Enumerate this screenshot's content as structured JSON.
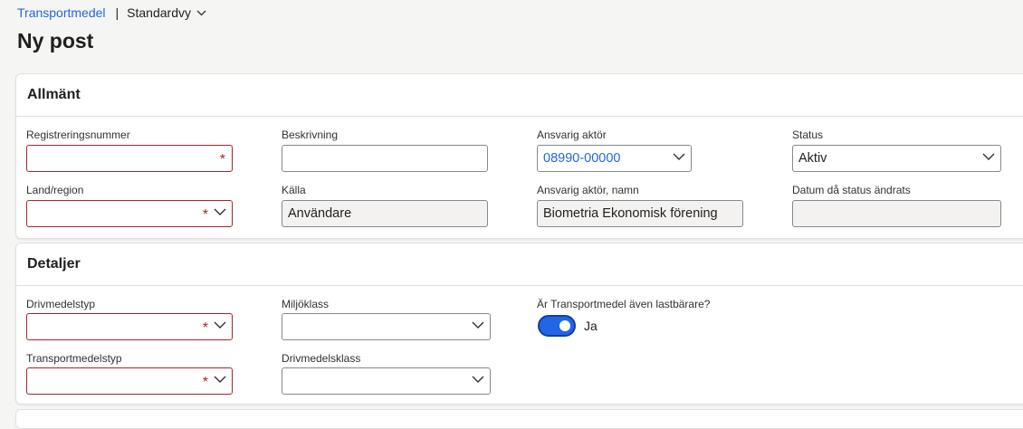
{
  "breadcrumb": {
    "link": "Transportmedel",
    "separator": "|",
    "view": "Standardvy"
  },
  "page_title": "Ny post",
  "sections": {
    "general": {
      "title": "Allmänt",
      "reg_label": "Registreringsnummer",
      "reg_value": "",
      "desc_label": "Beskrivning",
      "desc_value": "",
      "actor_label": "Ansvarig aktör",
      "actor_value": "08990-00000",
      "status_label": "Status",
      "status_value": "Aktiv",
      "country_label": "Land/region",
      "country_value": "",
      "source_label": "Källa",
      "source_value": "Användare",
      "actor_name_label": "Ansvarig aktör, namn",
      "actor_name_value": "Biometria Ekonomisk förening",
      "status_date_label": "Datum då status ändrats",
      "status_date_value": ""
    },
    "details": {
      "title": "Detaljer",
      "fuel_type_label": "Drivmedelstyp",
      "env_class_label": "Miljöklass",
      "carrier_label": "Är Transportmedel även lastbärare?",
      "carrier_toggle_on": true,
      "carrier_toggle_text": "Ja",
      "transport_type_label": "Transportmedelstyp",
      "fuel_class_label": "Drivmedelsklass"
    }
  },
  "required_marker": "*",
  "icons": {
    "chevron": "chevron-down-icon"
  },
  "colors": {
    "accent": "#2266e3",
    "required": "#a4262c"
  }
}
